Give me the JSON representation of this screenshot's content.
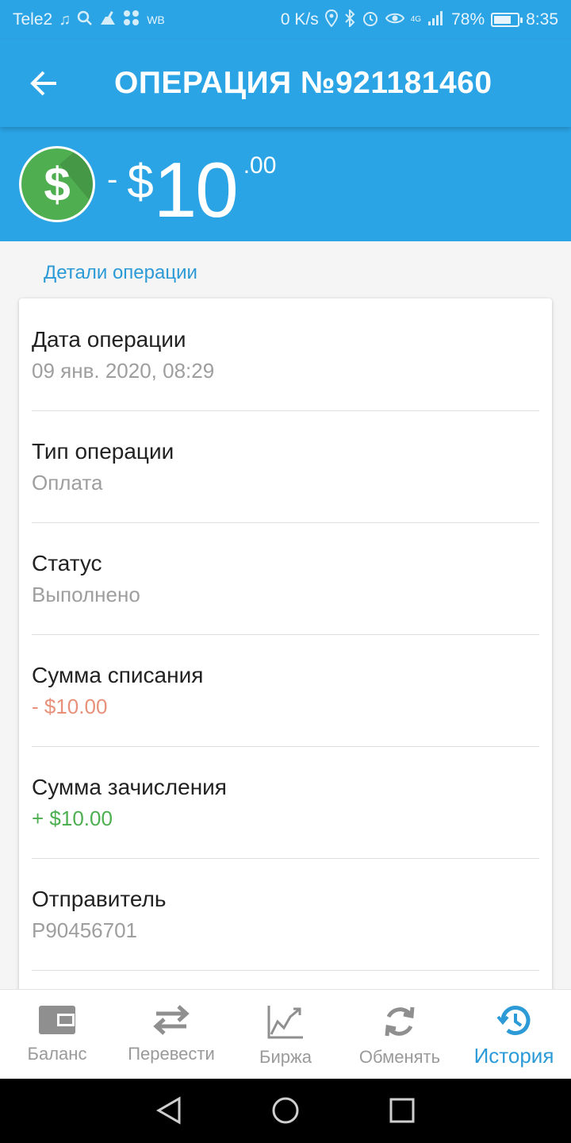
{
  "status_bar": {
    "carrier": "Tele2",
    "extra_label": "WB",
    "net_speed": "0 K/s",
    "network_label": "4G",
    "battery_percent": "78%",
    "battery_level": 0.78,
    "time": "8:35"
  },
  "header": {
    "title": "ОПЕРАЦИЯ №921181460",
    "back_icon": "arrow-left-icon"
  },
  "hero": {
    "sign": "-",
    "currency": "$",
    "amount_main": "10",
    "amount_cents": ".00",
    "coin_icon": "dollar-coin-icon",
    "coin_color": "#4fae4f"
  },
  "section": {
    "title": "Детали операции"
  },
  "details": [
    {
      "label": "Дата операции",
      "value": "09 янв. 2020, 08:29",
      "tone": "muted"
    },
    {
      "label": "Тип операции",
      "value": "Оплата",
      "tone": "muted"
    },
    {
      "label": "Статус",
      "value": "Выполнено",
      "tone": "muted"
    },
    {
      "label": "Сумма списания",
      "value": "- $10.00",
      "tone": "negative"
    },
    {
      "label": "Сумма зачисления",
      "value": "+ $10.00",
      "tone": "positive"
    },
    {
      "label": "Отправитель",
      "value": "P90456701",
      "tone": "muted"
    }
  ],
  "bottom_nav": {
    "items": [
      {
        "label": "Баланс",
        "icon": "wallet-icon"
      },
      {
        "label": "Перевести",
        "icon": "transfer-arrows-icon"
      },
      {
        "label": "Биржа",
        "icon": "chart-icon"
      },
      {
        "label": "Обменять",
        "icon": "exchange-icon"
      },
      {
        "label": "История",
        "icon": "history-icon",
        "active": true
      }
    ],
    "active_color": "#2b9ad6"
  },
  "colors": {
    "primary": "#2ba4e6",
    "negative": "#e8917a",
    "positive": "#4caf50"
  }
}
